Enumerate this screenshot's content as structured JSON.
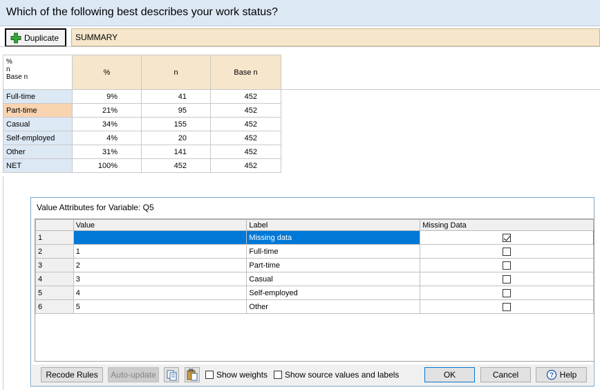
{
  "question": "Which of the following best describes your work status?",
  "toolbar": {
    "duplicate_label": "Duplicate",
    "summary_label": "SUMMARY"
  },
  "summary_table": {
    "corner_lines": [
      "%",
      "n",
      "Base n"
    ],
    "headers": [
      "%",
      "n",
      "Base n"
    ],
    "rows": [
      {
        "label": "Full-time",
        "pct": "9%",
        "n": "41",
        "base": "452"
      },
      {
        "label": "Part-time",
        "pct": "21%",
        "n": "95",
        "base": "452"
      },
      {
        "label": "Casual",
        "pct": "34%",
        "n": "155",
        "base": "452"
      },
      {
        "label": "Self-employed",
        "pct": "4%",
        "n": "20",
        "base": "452"
      },
      {
        "label": "Other",
        "pct": "31%",
        "n": "141",
        "base": "452"
      },
      {
        "label": "NET",
        "pct": "100%",
        "n": "452",
        "base": "452"
      }
    ]
  },
  "dialog": {
    "title": "Value Attributes for Variable: Q5",
    "columns": [
      "Value",
      "Label",
      "Missing Data"
    ],
    "rows": [
      {
        "num": "1",
        "value": "",
        "label": "Missing data",
        "missing": true
      },
      {
        "num": "2",
        "value": "1",
        "label": "Full-time",
        "missing": false
      },
      {
        "num": "3",
        "value": "2",
        "label": "Part-time",
        "missing": false
      },
      {
        "num": "4",
        "value": "3",
        "label": "Casual",
        "missing": false
      },
      {
        "num": "5",
        "value": "4",
        "label": "Self-employed",
        "missing": false
      },
      {
        "num": "6",
        "value": "5",
        "label": "Other",
        "missing": false
      }
    ],
    "buttons": {
      "recode_rules": "Recode Rules",
      "auto_update": "Auto-update",
      "show_weights": "Show weights",
      "show_source": "Show source values and labels",
      "ok": "OK",
      "cancel": "Cancel",
      "help": "Help"
    }
  },
  "colors": {
    "accent": "#0078d7",
    "header_blue": "#dde8f5",
    "header_tan": "#f6e6cb",
    "selected_row": "#f9d4b0"
  }
}
